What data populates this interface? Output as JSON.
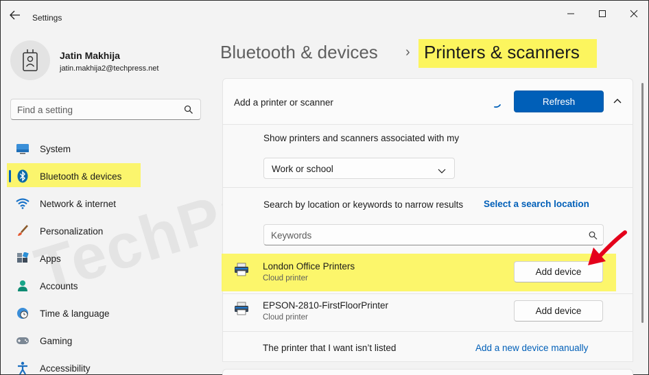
{
  "window": {
    "title": "Settings"
  },
  "profile": {
    "name": "Jatin Makhija",
    "email": "jatin.makhija2@techpress.net"
  },
  "search": {
    "placeholder": "Find a setting"
  },
  "sidebar": {
    "items": [
      {
        "label": "System",
        "icon": "monitor-icon"
      },
      {
        "label": "Bluetooth & devices",
        "icon": "bluetooth-icon",
        "active": true
      },
      {
        "label": "Network & internet",
        "icon": "wifi-icon"
      },
      {
        "label": "Personalization",
        "icon": "brush-icon"
      },
      {
        "label": "Apps",
        "icon": "apps-icon"
      },
      {
        "label": "Accounts",
        "icon": "person-icon"
      },
      {
        "label": "Time & language",
        "icon": "globe-clock-icon"
      },
      {
        "label": "Gaming",
        "icon": "gamepad-icon"
      },
      {
        "label": "Accessibility",
        "icon": "accessibility-icon"
      }
    ]
  },
  "breadcrumb": {
    "parent": "Bluetooth & devices",
    "separator": "›",
    "current": "Printers & scanners"
  },
  "add_card": {
    "label": "Add a printer or scanner",
    "refresh_label": "Refresh",
    "show_label": "Show printers and scanners associated with my",
    "scope_value": "Work or school",
    "search_label": "Search by location or keywords to narrow results",
    "location_link": "Select a search location",
    "keywords_placeholder": "Keywords"
  },
  "printers": [
    {
      "name": "London Office Printers",
      "type": "Cloud printer",
      "button": "Add device"
    },
    {
      "name": "EPSON-2810-FirstFloorPrinter",
      "type": "Cloud printer",
      "button": "Add device"
    }
  ],
  "footer": {
    "text": "The printer that I want isn’t listed",
    "link": "Add a new device manually"
  },
  "watermark": "TechPress.net",
  "colors": {
    "accent": "#005fb8",
    "highlight": "#fcf55e",
    "arrow": "#e4001b"
  }
}
